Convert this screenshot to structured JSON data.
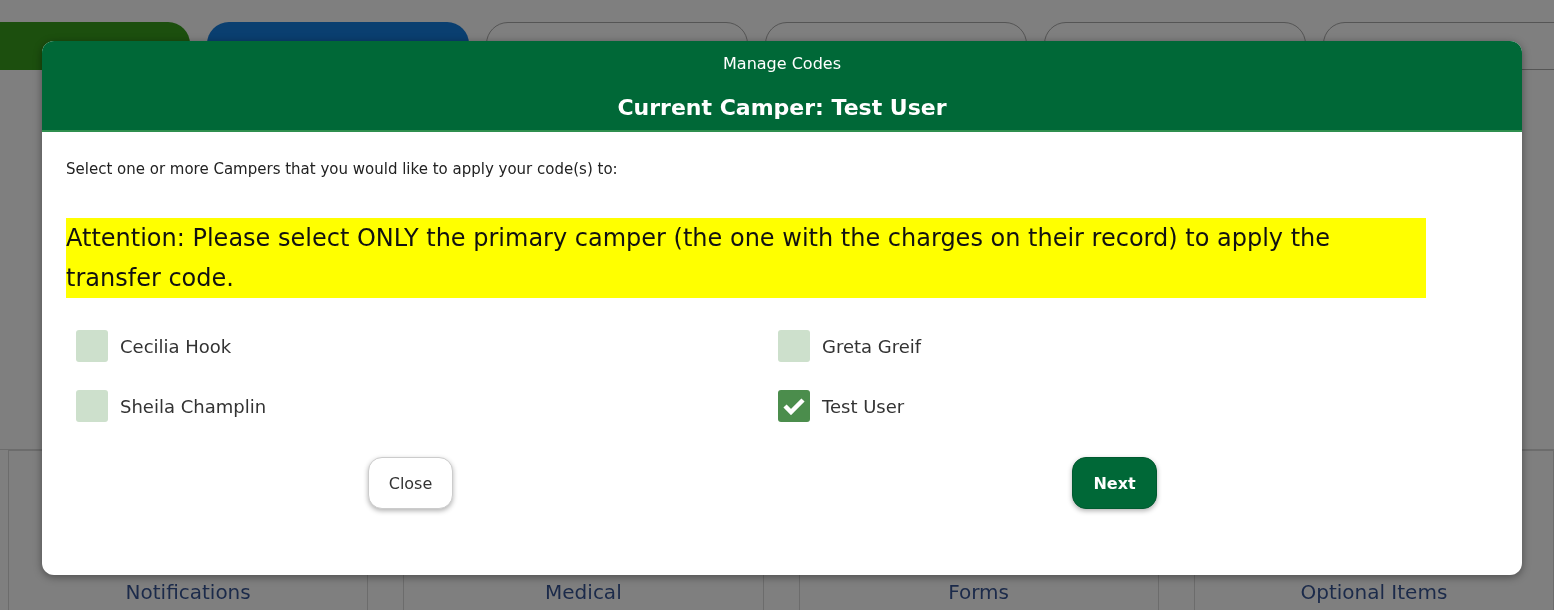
{
  "background": {
    "toolbar_buttons": [
      {
        "kind": "green"
      },
      {
        "kind": "blue"
      },
      {
        "kind": "outline"
      },
      {
        "kind": "outline"
      },
      {
        "kind": "outline"
      },
      {
        "kind": "outline"
      }
    ],
    "tiles": [
      "Notifications",
      "Medical",
      "Forms",
      "Optional Items"
    ]
  },
  "dialog": {
    "title": "Manage Codes",
    "subtitle": "Current Camper: Test User",
    "instruction": "Select one or more Campers that you would like to apply your code(s) to:",
    "attention": "Attention: Please select ONLY the primary camper (the one with the charges on their record) to apply the transfer code.",
    "campers": [
      {
        "name": "Cecilia Hook",
        "checked": false
      },
      {
        "name": "Greta Greif",
        "checked": false
      },
      {
        "name": "Sheila Champlin",
        "checked": false
      },
      {
        "name": "Test User",
        "checked": true
      }
    ],
    "buttons": [
      {
        "label": "Close",
        "kind": "secondary"
      },
      {
        "label": "Next",
        "kind": "primary"
      }
    ]
  }
}
